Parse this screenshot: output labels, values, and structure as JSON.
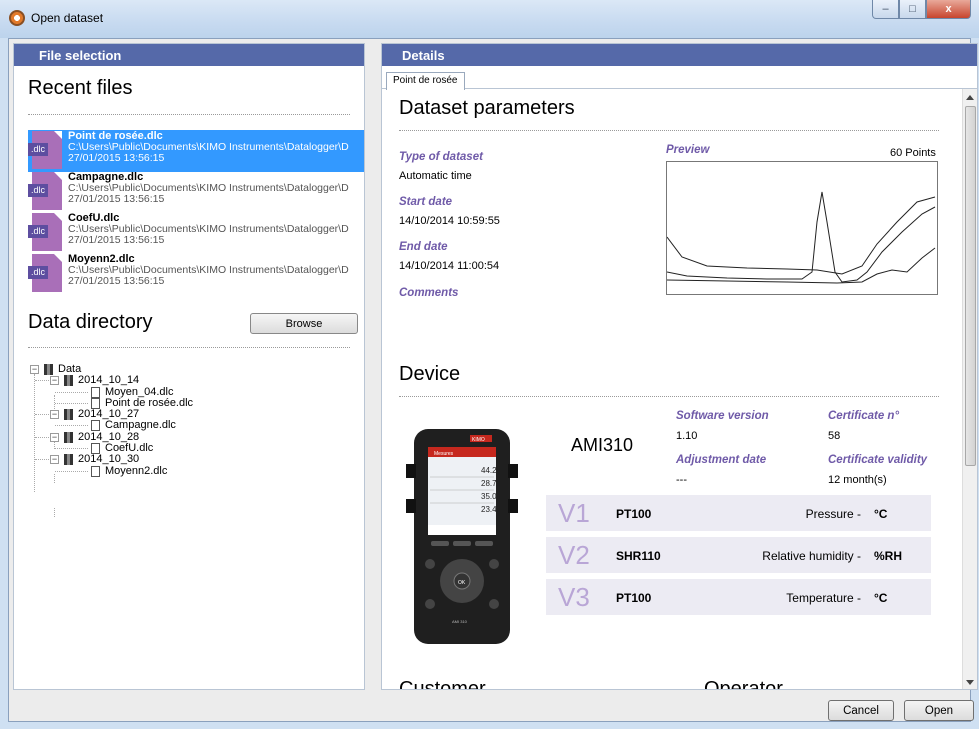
{
  "window": {
    "title": "Open dataset",
    "min": "–",
    "max": "□",
    "close": "x"
  },
  "file_selection": {
    "header": "File selection",
    "recent_title": "Recent files",
    "recent_files": [
      {
        "name": "Point de rosée.dlc",
        "path": "C:\\Users\\Public\\Documents\\KIMO Instruments\\Datalogger\\D",
        "date": "27/01/2015 13:56:15",
        "icon_label": ".dlc"
      },
      {
        "name": "Campagne.dlc",
        "path": "C:\\Users\\Public\\Documents\\KIMO Instruments\\Datalogger\\D",
        "date": "27/01/2015 13:56:15",
        "icon_label": ".dlc"
      },
      {
        "name": "CoefU.dlc",
        "path": "C:\\Users\\Public\\Documents\\KIMO Instruments\\Datalogger\\D",
        "date": "27/01/2015 13:56:15",
        "icon_label": ".dlc"
      },
      {
        "name": "Moyenn2.dlc",
        "path": "C:\\Users\\Public\\Documents\\KIMO Instruments\\Datalogger\\D",
        "date": "27/01/2015 13:56:15",
        "icon_label": ".dlc"
      }
    ],
    "data_directory_title": "Data directory",
    "browse_label": "Browse",
    "tree": {
      "root": "Data",
      "folders": [
        {
          "name": "2014_10_14",
          "files": [
            "Moyen_04.dlc",
            "Point de rosée.dlc"
          ]
        },
        {
          "name": "2014_10_27",
          "files": [
            "Campagne.dlc"
          ]
        },
        {
          "name": "2014_10_28",
          "files": [
            "CoefU.dlc"
          ]
        },
        {
          "name": "2014_10_30",
          "files": [
            "Moyenn2.dlc"
          ]
        }
      ]
    }
  },
  "details": {
    "header": "Details",
    "tab": "Point de rosée",
    "dataset_title": "Dataset parameters",
    "type_label": "Type of dataset",
    "type_value": "Automatic time",
    "start_label": "Start date",
    "start_value": "14/10/2014 10:59:55",
    "end_label": "End date",
    "end_value": "14/10/2014 11:00:54",
    "comments_label": "Comments",
    "preview_label": "Preview",
    "points": "60 Points",
    "device_title": "Device",
    "model": "AMI310",
    "software_label": "Software version",
    "software_value": "1.10",
    "certificate_label": "Certificate n°",
    "certificate_value": "58",
    "adjustment_label": "Adjustment date",
    "adjustment_value": "---",
    "validity_label": "Certificate validity",
    "validity_value": "12 month(s)",
    "channels": [
      {
        "v": "V1",
        "probe": "PT100",
        "measure": "Pressure  -",
        "unit": "°C"
      },
      {
        "v": "V2",
        "probe": "SHR110",
        "measure": "Relative humidity  -",
        "unit": "%RH"
      },
      {
        "v": "V3",
        "probe": "PT100",
        "measure": "Temperature  -",
        "unit": "°C"
      }
    ],
    "customer_title": "Customer",
    "operator_title": "Operator",
    "device_screen": {
      "brand": "KIMO",
      "menu": "Mesures",
      "readings": [
        "44.2",
        "28.7",
        "35.0",
        "23.4"
      ],
      "ok": "OK",
      "model_tag": "AMI 310"
    }
  },
  "buttons": {
    "cancel": "Cancel",
    "open": "Open"
  },
  "colors": {
    "header_bar": "#5569a9",
    "selection": "#3399ff",
    "accent_label": "#6f5aa8",
    "channel_bg": "#ecebf3",
    "channel_v": "#b9a6d6"
  }
}
